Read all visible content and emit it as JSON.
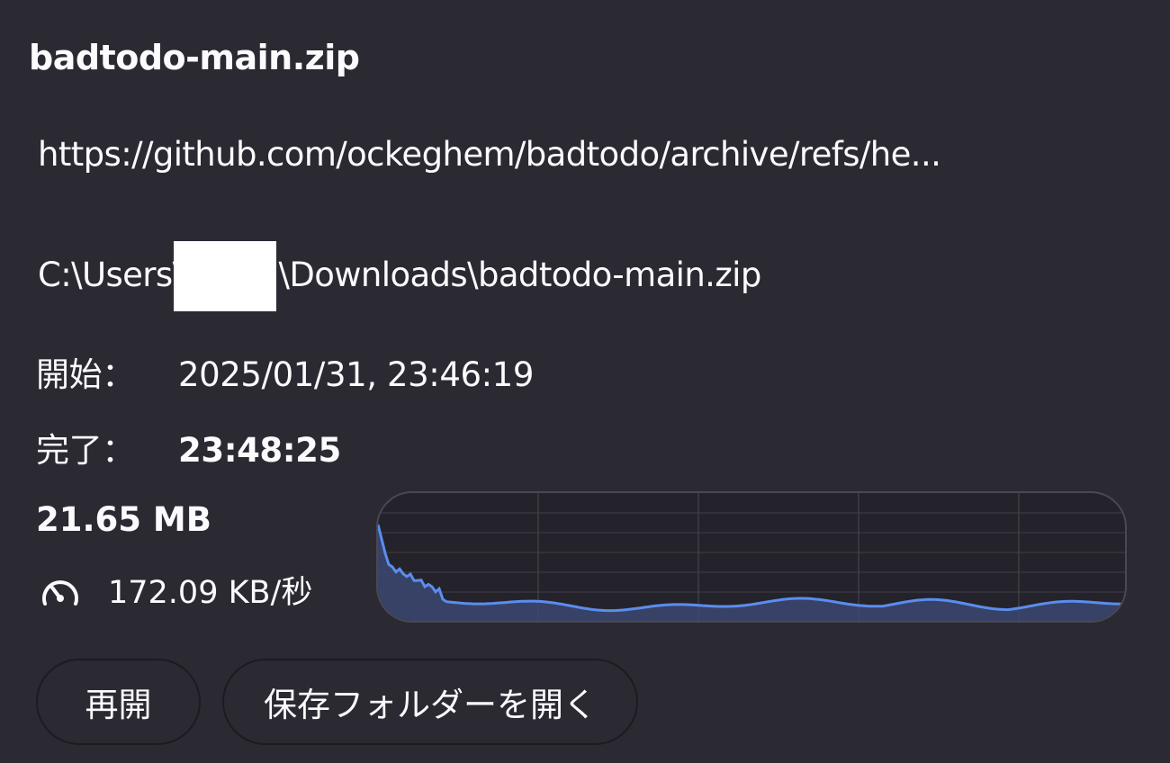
{
  "download": {
    "filename": "badtodo-main.zip",
    "url": "https://github.com/ockeghem/badtodo/archive/refs/he...",
    "path_prefix": "C:\\Users\\",
    "path_suffix": "\\Downloads\\badtodo-main.zip",
    "start_label": "開始：",
    "start_value": "2025/01/31, 23:46:19",
    "done_label": "完了：",
    "done_value": "23:48:25",
    "size": "21.65 MB",
    "speed": "172.09 KB/秒",
    "speed_icon": "gauge-icon"
  },
  "buttons": {
    "resume": "再開",
    "open_folder": "保存フォルダーを開く"
  },
  "colors": {
    "background": "#2b2a33",
    "graph_line": "#5b8def",
    "graph_fill": "#3d4a75",
    "text": "#fbfbfe"
  }
}
